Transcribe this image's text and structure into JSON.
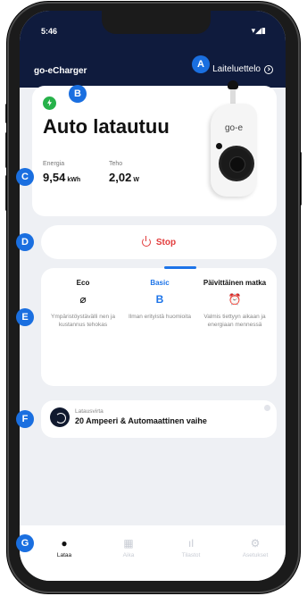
{
  "status_bar": {
    "time": "5:46",
    "icons": "▾◢▮"
  },
  "header": {
    "app_title": "go-eCharger",
    "device_list_label": "Laiteluettelo"
  },
  "charging": {
    "status": "Auto latautuu",
    "energy_label": "Energia",
    "energy_value": "9,54",
    "energy_unit": "kWh",
    "power_label": "Teho",
    "power_value": "2,02",
    "power_unit": "W"
  },
  "charger_logo": "go-e",
  "stop_button": {
    "label": "Stop"
  },
  "modes": [
    {
      "title": "Eco",
      "icon": "⌀",
      "desc": "Ympäristöystävälli nen ja kustannus tehokas"
    },
    {
      "title": "Basic",
      "icon": "B",
      "desc": "Ilman erityistä huomioita"
    },
    {
      "title": "Päivittäinen matka",
      "icon": "⏰",
      "desc": "Valmis tiettyyn aikaan ja energiaan mennessä"
    }
  ],
  "current": {
    "label": "Latausvirta",
    "value": "20 Ampeeri & Automaattinen vaihe"
  },
  "nav": [
    {
      "label": "Lataa",
      "icon": "plug-icon"
    },
    {
      "label": "Aika",
      "icon": "calendar-icon"
    },
    {
      "label": "Tilastot",
      "icon": "bar-chart-icon"
    },
    {
      "label": "Asetukset",
      "icon": "gear-icon"
    }
  ],
  "callouts": [
    "A",
    "B",
    "C",
    "D",
    "E",
    "F",
    "G"
  ],
  "colors": {
    "header_bg": "#0f1b3d",
    "accent": "#1d74e8",
    "stop": "#e23b3b",
    "success": "#27b24a",
    "callout": "#1a6fe0"
  }
}
